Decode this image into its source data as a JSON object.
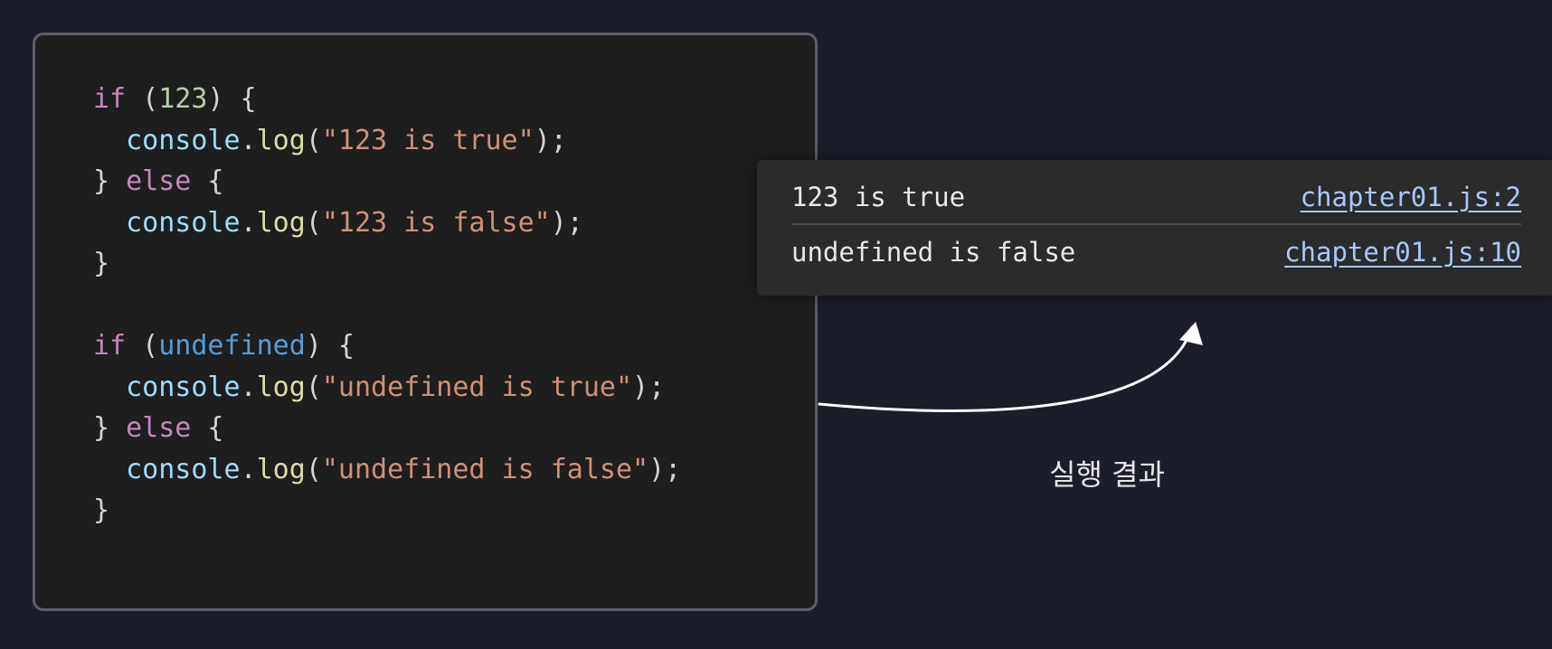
{
  "code": {
    "lines": [
      [
        [
          "kw",
          "if"
        ],
        [
          "punc",
          " ("
        ],
        [
          "num",
          "123"
        ],
        [
          "punc",
          ") {"
        ]
      ],
      [
        [
          "punc",
          "  "
        ],
        [
          "ident",
          "console"
        ],
        [
          "punc",
          "."
        ],
        [
          "fn",
          "log"
        ],
        [
          "punc",
          "("
        ],
        [
          "str",
          "\"123 is true\""
        ],
        [
          "punc",
          ");"
        ]
      ],
      [
        [
          "punc",
          "} "
        ],
        [
          "kw",
          "else"
        ],
        [
          "punc",
          " {"
        ]
      ],
      [
        [
          "punc",
          "  "
        ],
        [
          "ident",
          "console"
        ],
        [
          "punc",
          "."
        ],
        [
          "fn",
          "log"
        ],
        [
          "punc",
          "("
        ],
        [
          "str",
          "\"123 is false\""
        ],
        [
          "punc",
          ");"
        ]
      ],
      [
        [
          "punc",
          "}"
        ]
      ],
      [],
      [
        [
          "kw",
          "if"
        ],
        [
          "punc",
          " ("
        ],
        [
          "const",
          "undefined"
        ],
        [
          "punc",
          ") {"
        ]
      ],
      [
        [
          "punc",
          "  "
        ],
        [
          "ident",
          "console"
        ],
        [
          "punc",
          "."
        ],
        [
          "fn",
          "log"
        ],
        [
          "punc",
          "("
        ],
        [
          "str",
          "\"undefined is true\""
        ],
        [
          "punc",
          ");"
        ]
      ],
      [
        [
          "punc",
          "} "
        ],
        [
          "kw",
          "else"
        ],
        [
          "punc",
          " {"
        ]
      ],
      [
        [
          "punc",
          "  "
        ],
        [
          "ident",
          "console"
        ],
        [
          "punc",
          "."
        ],
        [
          "fn",
          "log"
        ],
        [
          "punc",
          "("
        ],
        [
          "str",
          "\"undefined is false\""
        ],
        [
          "punc",
          ");"
        ]
      ],
      [
        [
          "punc",
          "}"
        ]
      ]
    ]
  },
  "console": {
    "rows": [
      {
        "message": "123 is true",
        "source": "chapter01.js:2"
      },
      {
        "message": "undefined is false",
        "source": "chapter01.js:10"
      }
    ]
  },
  "caption": "실행 결과",
  "colors": {
    "background": "#1c1d2a",
    "keyword": "#c586c0",
    "number": "#b5cea8",
    "identifier": "#9cdcfe",
    "function": "#dcdcaa",
    "string": "#ce9178",
    "constant": "#569cd6",
    "link": "#a8c7fa"
  }
}
